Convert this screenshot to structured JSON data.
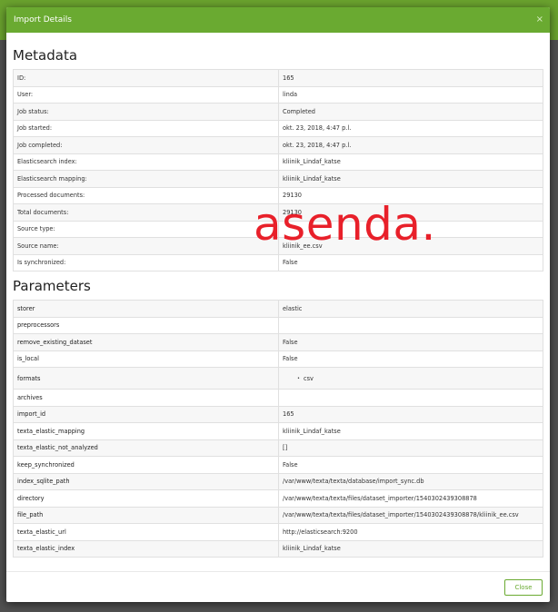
{
  "modal": {
    "title": "Import Details",
    "close_icon": "×",
    "metadata_heading": "Metadata",
    "parameters_heading": "Parameters",
    "close_button": "Close"
  },
  "metadata": [
    {
      "key": "ID:",
      "value": "165"
    },
    {
      "key": "User:",
      "value": "linda"
    },
    {
      "key": "Job status:",
      "value": "Completed"
    },
    {
      "key": "Job started:",
      "value": "okt. 23, 2018, 4:47 p.l."
    },
    {
      "key": "Job completed:",
      "value": "okt. 23, 2018, 4:47 p.l."
    },
    {
      "key": "Elasticsearch index:",
      "value": "kliinik_Lindaf_katse"
    },
    {
      "key": "Elasticsearch mapping:",
      "value": "kliinik_Lindaf_katse"
    },
    {
      "key": "Processed documents:",
      "value": "29130"
    },
    {
      "key": "Total documents:",
      "value": "29130"
    },
    {
      "key": "Source type:",
      "value": ""
    },
    {
      "key": "Source name:",
      "value": "kliinik_ee.csv"
    },
    {
      "key": "Is synchronized:",
      "value": "False"
    }
  ],
  "parameters": [
    {
      "key": "storer",
      "value": "elastic"
    },
    {
      "key": "preprocessors",
      "value": ""
    },
    {
      "key": "remove_existing_dataset",
      "value": "False"
    },
    {
      "key": "is_local",
      "value": "False"
    },
    {
      "key": "formats",
      "value": "csv"
    },
    {
      "key": "archives",
      "value": ""
    },
    {
      "key": "import_id",
      "value": "165"
    },
    {
      "key": "texta_elastic_mapping",
      "value": "kliinik_Lindaf_katse"
    },
    {
      "key": "texta_elastic_not_analyzed",
      "value": "[]"
    },
    {
      "key": "keep_synchronized",
      "value": "False"
    },
    {
      "key": "index_sqlite_path",
      "value": "/var/www/texta/texta/database/import_sync.db"
    },
    {
      "key": "directory",
      "value": "/var/www/texta/texta/files/dataset_importer/1540302439308878"
    },
    {
      "key": "file_path",
      "value": "/var/www/texta/texta/files/dataset_importer/1540302439308878/kliinik_ee.csv"
    },
    {
      "key": "texta_elastic_url",
      "value": "http://elasticsearch:9200"
    },
    {
      "key": "texta_elastic_index",
      "value": "kliinik_Lindaf_katse"
    }
  ],
  "overlay": {
    "text": "asenda."
  },
  "colors": {
    "accent": "#6aaa31",
    "overlay": "#e8202a"
  }
}
